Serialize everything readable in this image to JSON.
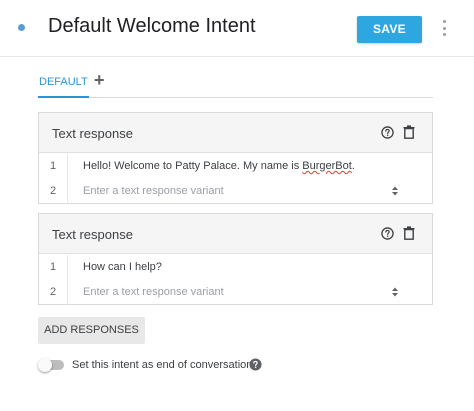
{
  "header": {
    "title": "Default Welcome Intent",
    "save_label": "SAVE",
    "status_dot_color": "#5b9bd5",
    "accent_color": "#2ea7e0",
    "more_icon": "more-vert-icon"
  },
  "tabs": {
    "items": [
      {
        "label": "DEFAULT",
        "active": true
      }
    ],
    "add_icon": "plus-icon"
  },
  "cards": [
    {
      "title": "Text response",
      "icons": [
        "help-icon",
        "trash-icon"
      ],
      "rows": [
        {
          "num": "1",
          "text_prefix": "Hello! Welcome to Patty Palace. My name is ",
          "misspelled": "BurgerBot",
          "text_suffix": "."
        },
        {
          "num": "2",
          "placeholder": "Enter a text response variant"
        }
      ]
    },
    {
      "title": "Text response",
      "icons": [
        "help-icon",
        "trash-icon"
      ],
      "rows": [
        {
          "num": "1",
          "text": "How can I help?"
        },
        {
          "num": "2",
          "placeholder": "Enter a text response variant"
        }
      ]
    }
  ],
  "add_responses_label": "ADD RESPONSES",
  "end_conversation": {
    "label": "Set this intent as end of conversation",
    "enabled": false,
    "help_icon": "help-icon"
  }
}
